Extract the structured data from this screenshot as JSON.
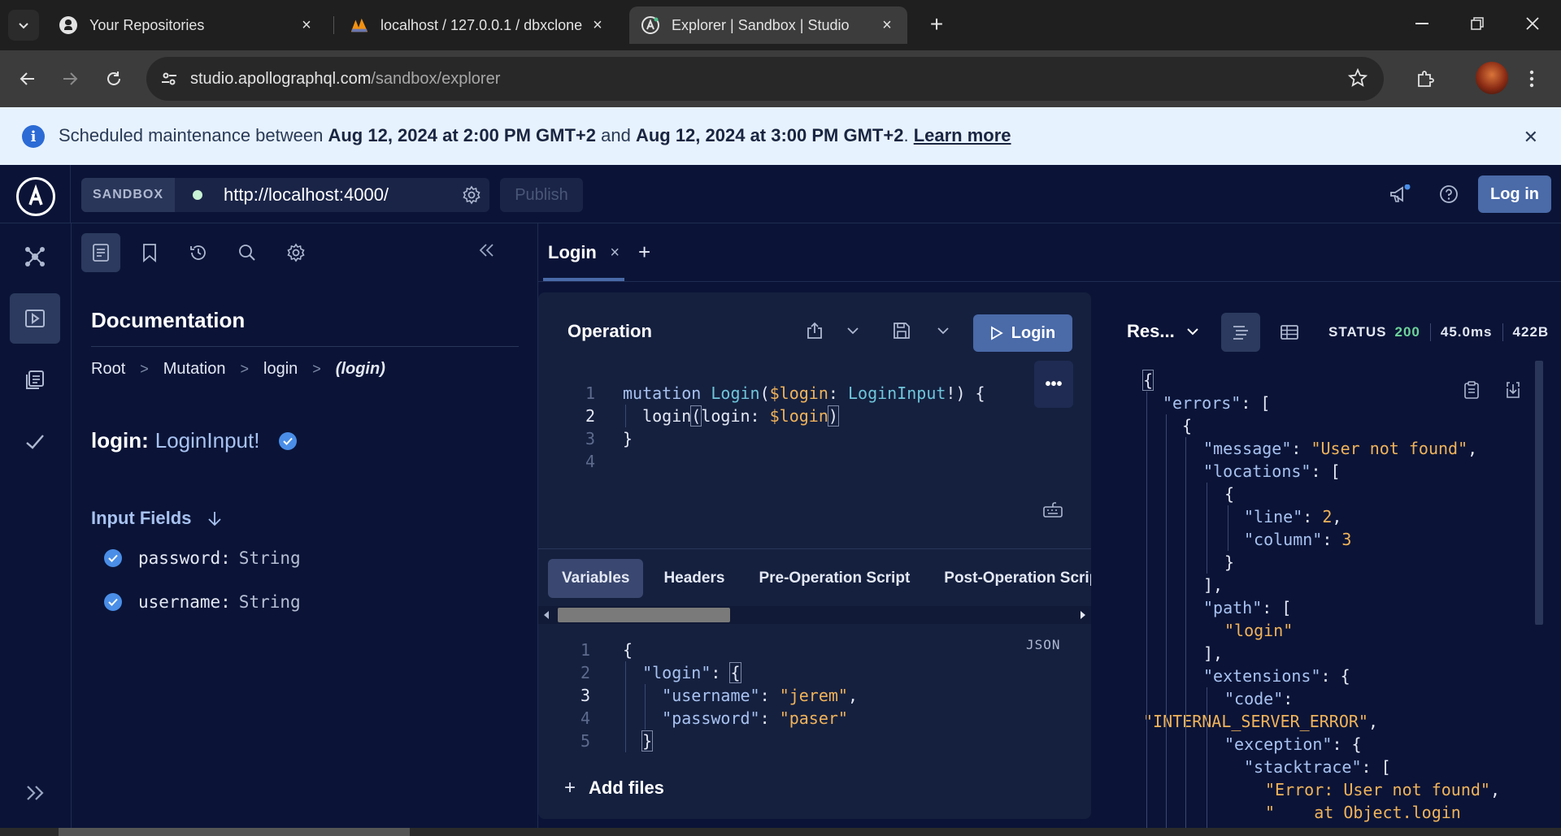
{
  "browser": {
    "tabs": [
      {
        "title": "Your Repositories",
        "icon": "github-icon"
      },
      {
        "title": "localhost / 127.0.0.1 / dbxclone",
        "icon": "phpmyadmin-icon"
      },
      {
        "title": "Explorer | Sandbox | Studio",
        "icon": "apollo-icon",
        "active": true
      }
    ],
    "url_host": "studio.apollographql.com",
    "url_path": "/sandbox/explorer"
  },
  "banner": {
    "prefix": "Scheduled maintenance between ",
    "start": "Aug 12, 2024 at 2:00 PM GMT+2",
    "middle": " and ",
    "end": "Aug 12, 2024 at 3:00 PM GMT+2",
    "suffix": ". ",
    "link": "Learn more"
  },
  "header": {
    "sandbox_label": "SANDBOX",
    "endpoint": "http://localhost:4000/",
    "publish_label": "Publish",
    "login_label": "Log in"
  },
  "docs": {
    "title": "Documentation",
    "breadcrumb": [
      "Root",
      "Mutation",
      "login",
      "(login)"
    ],
    "field_name": "login:",
    "field_type": "LoginInput!",
    "input_fields_title": "Input Fields",
    "input_fields": [
      {
        "name": "password:",
        "type": "String"
      },
      {
        "name": "username:",
        "type": "String"
      }
    ]
  },
  "operation_tab": {
    "label": "Login",
    "close": "×"
  },
  "operation": {
    "title": "Operation",
    "run_label": "Login",
    "more": "•••",
    "line_numbers": [
      "1",
      "2",
      "3",
      "4"
    ]
  },
  "variables": {
    "tabs": [
      "Variables",
      "Headers",
      "Pre-Operation Script",
      "Post-Operation Script"
    ],
    "format_label": "JSON",
    "line_numbers": [
      "1",
      "2",
      "3",
      "4",
      "5"
    ],
    "add_files_label": "Add files"
  },
  "response": {
    "title": "Res...",
    "status_label": "STATUS",
    "status_code": "200",
    "time": "45.0ms",
    "size": "422B"
  }
}
